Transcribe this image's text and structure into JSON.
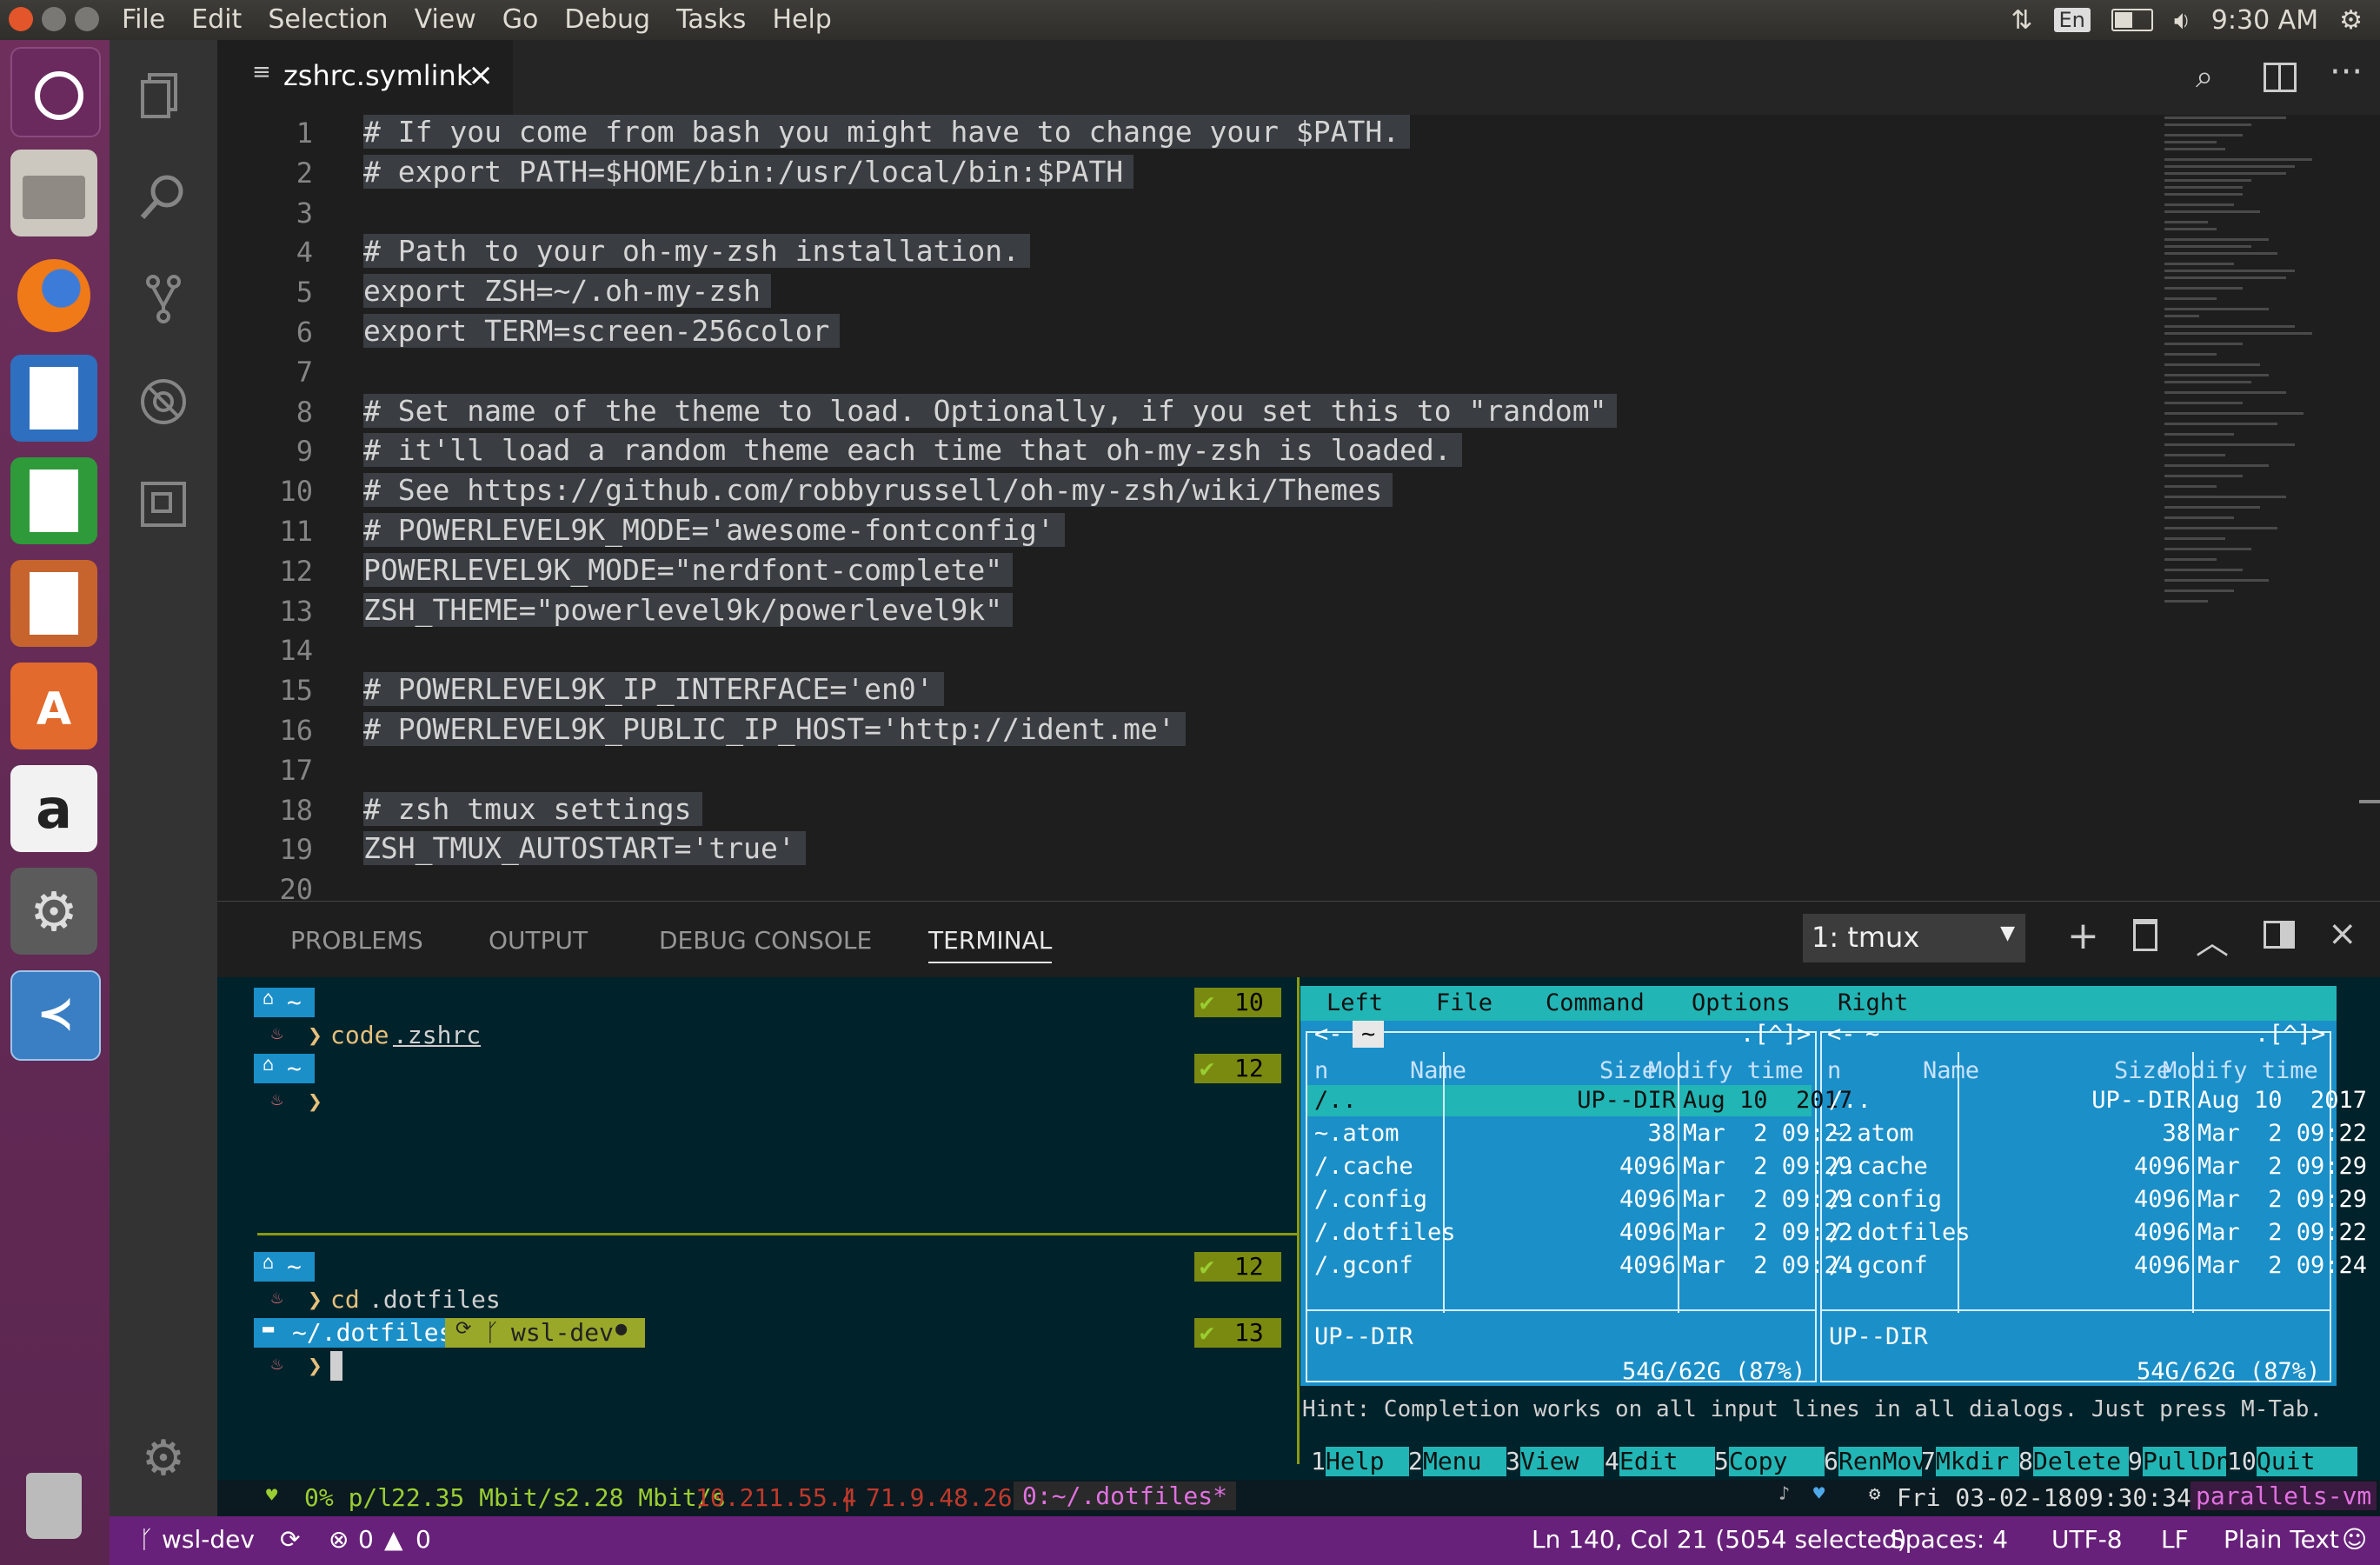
{
  "menubar": {
    "items": [
      "File",
      "Edit",
      "Selection",
      "View",
      "Go",
      "Debug",
      "Tasks",
      "Help"
    ],
    "keyboard_layout": "En",
    "clock": "9:30 AM"
  },
  "launcher": {
    "icons": [
      "ubuntu-logo-icon",
      "files-icon",
      "firefox-icon",
      "writer-icon",
      "calc-icon",
      "impress-icon",
      "software-center-icon",
      "amazon-icon",
      "settings-icon",
      "vscode-icon",
      "trash-icon"
    ]
  },
  "tab": {
    "title": "zshrc.symlink",
    "close": "×"
  },
  "editor": {
    "line_numbers": [
      "1",
      "2",
      "3",
      "4",
      "5",
      "6",
      "7",
      "8",
      "9",
      "10",
      "11",
      "12",
      "13",
      "14",
      "15",
      "16",
      "17",
      "18",
      "19",
      "20"
    ],
    "lines": [
      "# If you come from bash you might have to change your $PATH.",
      "# export PATH=$HOME/bin:/usr/local/bin:$PATH",
      "",
      "# Path to your oh-my-zsh installation.",
      "export ZSH=~/.oh-my-zsh",
      "export TERM=screen-256color",
      "",
      "# Set name of the theme to load. Optionally, if you set this to \"random\"",
      "# it'll load a random theme each time that oh-my-zsh is loaded.",
      "# See https://github.com/robbyrussell/oh-my-zsh/wiki/Themes",
      "# POWERLEVEL9K_MODE='awesome-fontconfig'",
      "POWERLEVEL9K_MODE=\"nerdfont-complete\"",
      "ZSH_THEME=\"powerlevel9k/powerlevel9k\"",
      "",
      "# POWERLEVEL9K_IP_INTERFACE='en0'",
      "# POWERLEVEL9K_PUBLIC_IP_HOST='http://ident.me'",
      "",
      "# zsh tmux settings",
      "ZSH_TMUX_AUTOSTART='true'",
      ""
    ]
  },
  "panel": {
    "tabs": [
      "PROBLEMS",
      "OUTPUT",
      "DEBUG CONSOLE",
      "TERMINAL"
    ],
    "active_tab": "TERMINAL",
    "terminal_select": "1: tmux"
  },
  "terminal": {
    "prompt_home": "~",
    "cmd1": "code",
    "cmd1_arg": ".zshrc",
    "cmd2": "cd",
    "cmd2_arg": ".dotfiles",
    "counts": [
      "10",
      "12",
      "12",
      "13"
    ],
    "dir_segment": "~/.dotfiles",
    "git_segment": "wsl-dev",
    "status_line": {
      "load": "0% p/l",
      "down": "22.35 Mbit/s",
      "up": "2.28 Mbit/s",
      "ip1": "10.211.55.4",
      "ip2": "71.9.48.265",
      "window": "0:~/.dotfiles*",
      "datetime": "Fri 03-02-18",
      "time": "09:30:34",
      "host": "parallels-vm"
    }
  },
  "mc": {
    "menu": [
      "Left",
      "File",
      "Command",
      "Options",
      "Right"
    ],
    "path_left": "~",
    "path_indicator": ".[^]>",
    "path_right": "~",
    "col_name": "Name",
    "col_size": "Size",
    "col_time": "Modify time",
    "col_n": "n",
    "rows": [
      {
        "name": "/..",
        "size": "UP--DIR",
        "time": "Aug 10  2017"
      },
      {
        "name": "~.atom",
        "size": "38",
        "time": "Mar  2 09:22"
      },
      {
        "name": "/.cache",
        "size": "4096",
        "time": "Mar  2 09:29"
      },
      {
        "name": "/.config",
        "size": "4096",
        "time": "Mar  2 09:29"
      },
      {
        "name": "/.dotfiles",
        "size": "4096",
        "time": "Mar  2 09:22"
      },
      {
        "name": "/.gconf",
        "size": "4096",
        "time": "Mar  2 09:24"
      }
    ],
    "footer_left": "UP--DIR",
    "footer_right": "UP--DIR",
    "disk_left": "54G/62G (87%)",
    "disk_right": "54G/62G (87%)",
    "hint": "Hint: Completion works on all input lines in all dialogs. Just press M-Tab.",
    "fkeys": [
      {
        "n": "1",
        "label": "Help"
      },
      {
        "n": "2",
        "label": "Menu"
      },
      {
        "n": "3",
        "label": "View"
      },
      {
        "n": "4",
        "label": "Edit"
      },
      {
        "n": "5",
        "label": "Copy"
      },
      {
        "n": "6",
        "label": "RenMov"
      },
      {
        "n": "7",
        "label": "Mkdir"
      },
      {
        "n": "8",
        "label": "Delete"
      },
      {
        "n": "9",
        "label": "PullDn"
      },
      {
        "n": "10",
        "label": "Quit"
      }
    ]
  },
  "statusbar": {
    "branch": "wsl-dev",
    "errors": "0",
    "warnings": "0",
    "position": "Ln 140, Col 21 (5054 selected)",
    "spaces": "Spaces: 4",
    "encoding": "UTF-8",
    "eol": "LF",
    "language": "Plain Text"
  },
  "colors": {
    "accent_purple": "#68217a",
    "terminal_bg": "#00222b",
    "mc_blue": "#1b8fc8",
    "mc_cyan": "#22b5b5"
  }
}
